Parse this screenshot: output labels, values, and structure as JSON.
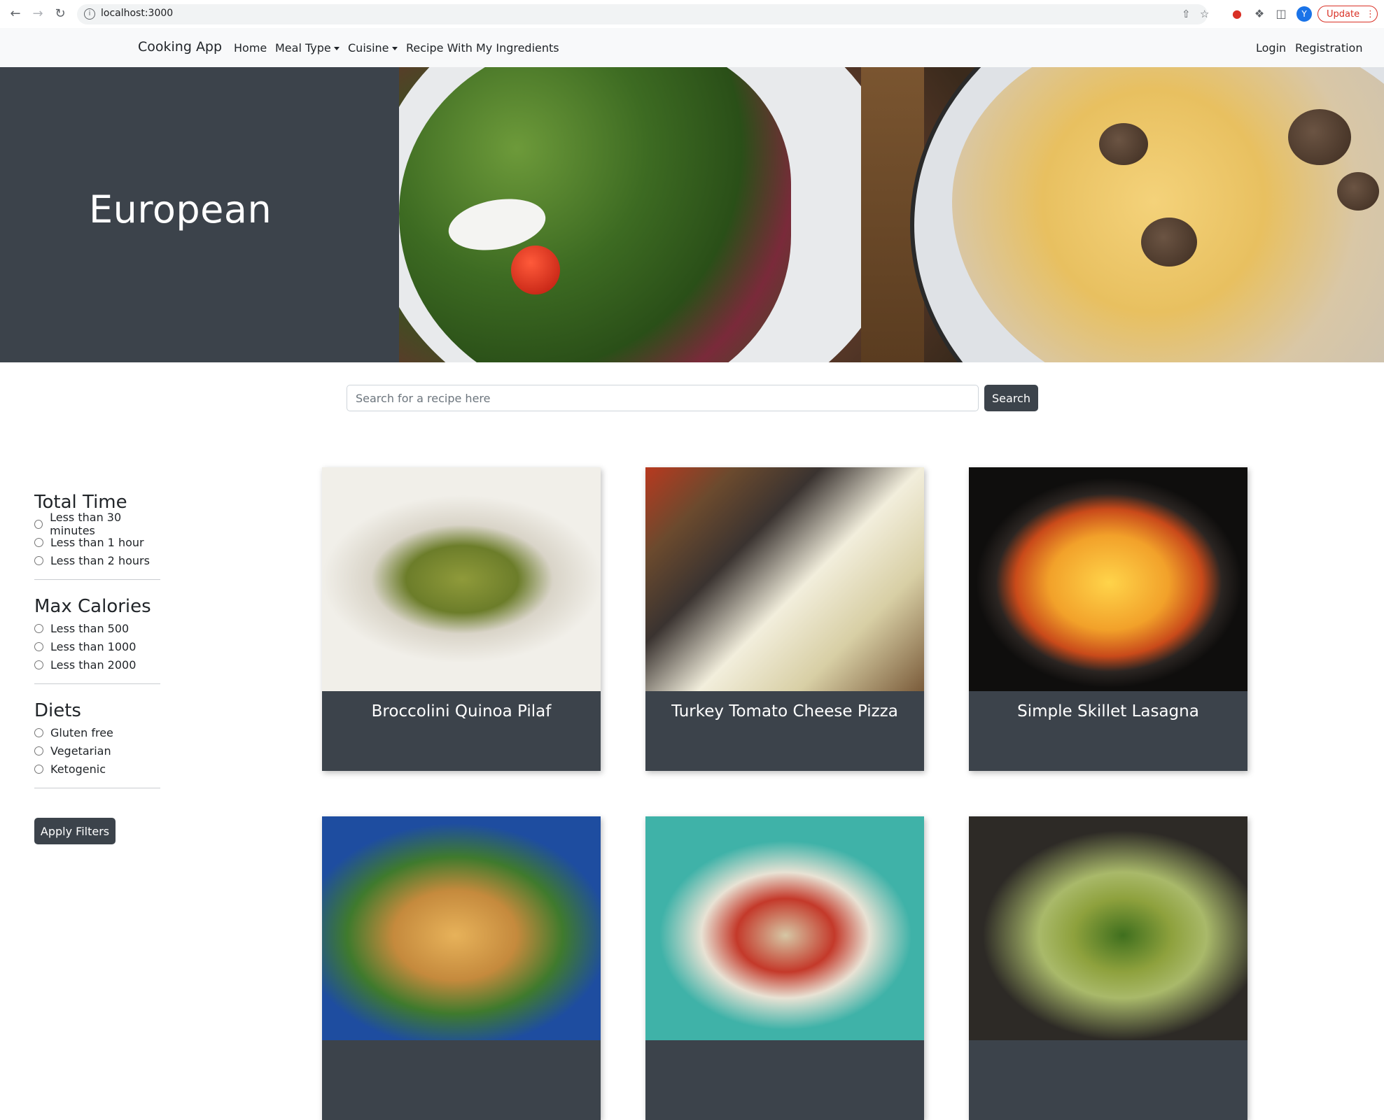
{
  "browser": {
    "url": "localhost:3000",
    "profile_initial": "Y",
    "update_label": "Update"
  },
  "navbar": {
    "brand": "Cooking App",
    "links": [
      {
        "label": "Home"
      },
      {
        "label": "Meal Type"
      },
      {
        "label": "Cuisine"
      },
      {
        "label": "Recipe With My Ingredients"
      }
    ],
    "right_links": [
      {
        "label": "Login"
      },
      {
        "label": "Registration"
      }
    ]
  },
  "hero": {
    "title": "European"
  },
  "search": {
    "placeholder": "Search for a recipe here",
    "button_label": "Search"
  },
  "filters": {
    "groups": [
      {
        "title": "Total Time",
        "options": [
          "Less than 30 minutes",
          "Less than 1 hour",
          "Less than 2 hours"
        ]
      },
      {
        "title": "Max Calories",
        "options": [
          "Less than 500",
          "Less than 1000",
          "Less than 2000"
        ]
      },
      {
        "title": "Diets",
        "options": [
          "Gluten free",
          "Vegetarian",
          "Ketogenic"
        ]
      }
    ],
    "apply_label": "Apply Filters"
  },
  "recipes": [
    {
      "title": "Broccolini Quinoa Pilaf"
    },
    {
      "title": "Turkey Tomato Cheese Pizza"
    },
    {
      "title": "Simple Skillet Lasagna"
    },
    {
      "title": ""
    },
    {
      "title": ""
    },
    {
      "title": ""
    }
  ]
}
